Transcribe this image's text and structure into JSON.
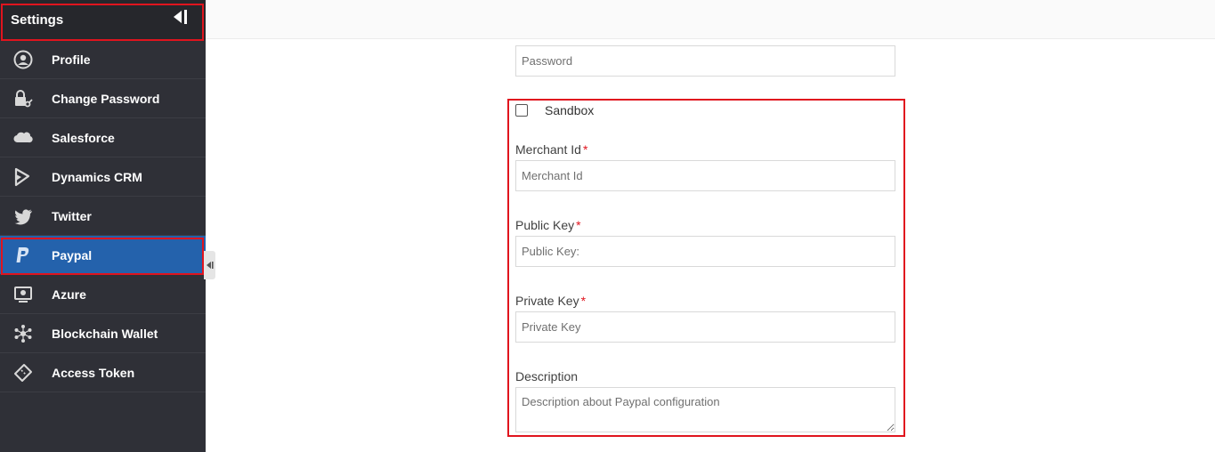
{
  "sidebar": {
    "title": "Settings",
    "items": [
      {
        "label": "Profile",
        "icon": "user-circle-icon"
      },
      {
        "label": "Change Password",
        "icon": "lock-key-icon"
      },
      {
        "label": "Salesforce",
        "icon": "salesforce-cloud-icon"
      },
      {
        "label": "Dynamics CRM",
        "icon": "dynamics-icon"
      },
      {
        "label": "Twitter",
        "icon": "twitter-bird-icon"
      },
      {
        "label": "Paypal",
        "icon": "paypal-icon",
        "active": true
      },
      {
        "label": "Azure",
        "icon": "azure-monitor-icon"
      },
      {
        "label": "Blockchain Wallet",
        "icon": "blockchain-icon"
      },
      {
        "label": "Access Token",
        "icon": "ticket-icon"
      }
    ]
  },
  "form": {
    "password_placeholder": "Password",
    "sandbox_label": "Sandbox",
    "sandbox_checked": false,
    "merchant_label": "Merchant Id",
    "merchant_placeholder": "Merchant Id",
    "public_label": "Public Key",
    "public_placeholder": "Public Key:",
    "private_label": "Private Key",
    "private_placeholder": "Private Key",
    "description_label": "Description",
    "description_placeholder": "Description about Paypal configuration",
    "required_mark": "*"
  },
  "colors": {
    "sidebar_bg": "#2f3037",
    "active_bg": "#2462ac",
    "highlight": "#e0141e"
  }
}
